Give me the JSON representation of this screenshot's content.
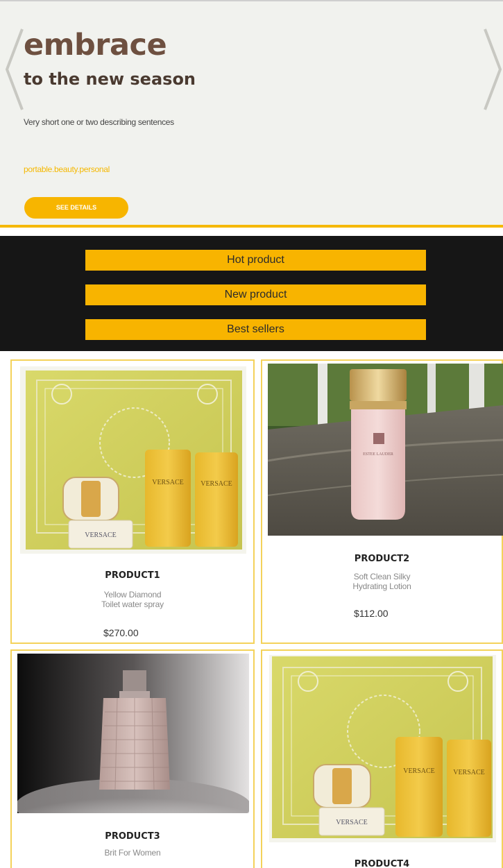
{
  "hero": {
    "title": "embrace",
    "subtitle": "to the new season",
    "description": "Very short one or two describing sentences",
    "tags": "portable.beauty.personal",
    "cta_label": "SEE DETAILS",
    "accent_color": "#f5b800"
  },
  "nav": {
    "items": [
      {
        "label": "Hot product"
      },
      {
        "label": "New product"
      },
      {
        "label": "Best sellers"
      }
    ]
  },
  "products": [
    {
      "name": "PRODUCT1",
      "desc_line1": "Yellow Diamond",
      "desc_line2": "Toilet water spray",
      "price": "$270.00",
      "image": "versace-gift-set"
    },
    {
      "name": "PRODUCT2",
      "desc_line1": "Soft Clean Silky",
      "desc_line2": "Hydrating Lotion",
      "price": "$112.00",
      "image": "pink-lotion-bottle"
    },
    {
      "name": "PRODUCT3",
      "desc_line1": "Brit For Women",
      "desc_line2": "",
      "price": "",
      "image": "perfume-bottle"
    },
    {
      "name": "PRODUCT4",
      "desc_line1": "",
      "desc_line2": "",
      "price": "",
      "image": "versace-gift-set"
    }
  ],
  "icons": {
    "prev": "chevron-left-icon",
    "next": "chevron-right-icon"
  }
}
